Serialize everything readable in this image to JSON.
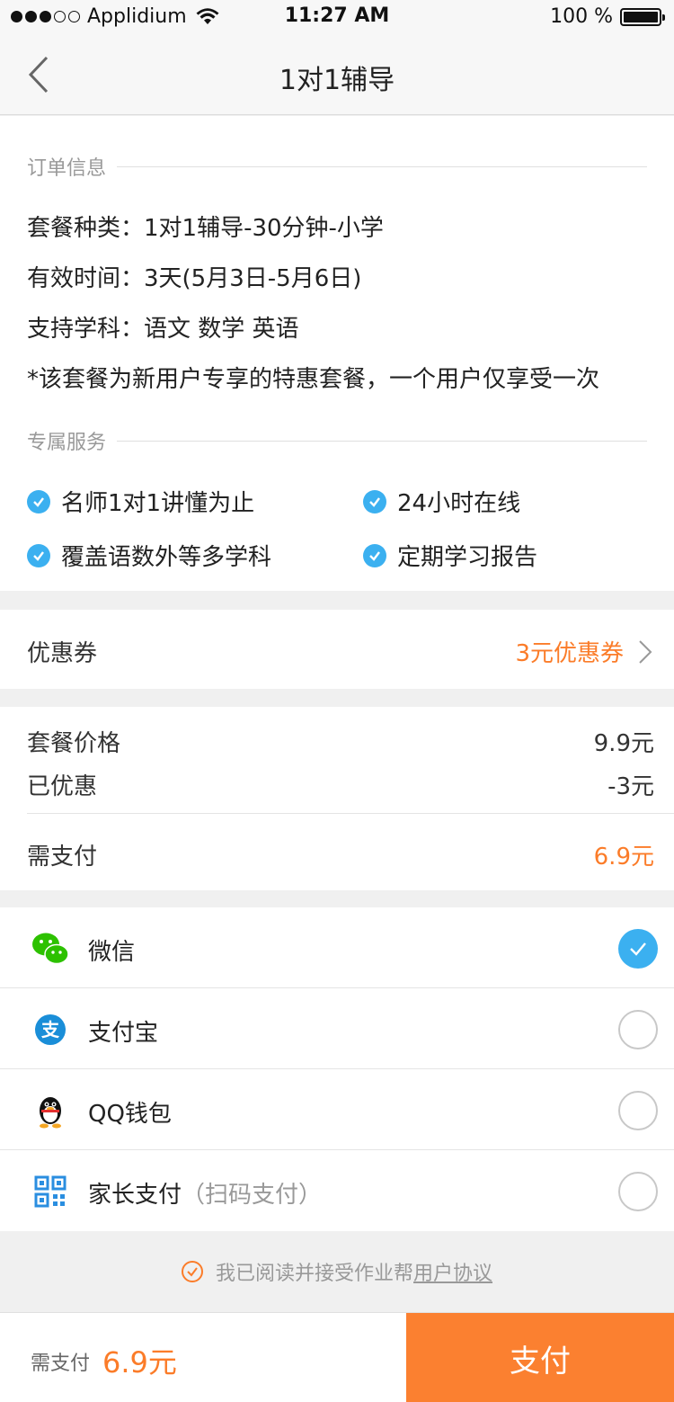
{
  "status_bar": {
    "carrier": "Applidium",
    "time": "11:27 AM",
    "battery": "100 %"
  },
  "nav": {
    "title": "1对1辅导"
  },
  "order": {
    "section_title": "订单信息",
    "package_type": "套餐种类：1对1辅导-30分钟-小学",
    "valid_time": "有效时间：3天(5月3日-5月6日)",
    "subjects": "支持学科：语文 数学 英语",
    "note": "*该套餐为新用户专享的特惠套餐，一个用户仅享受一次"
  },
  "services": {
    "section_title": "专属服务",
    "items": [
      "名师1对1讲懂为止",
      "24小时在线",
      "覆盖语数外等多学科",
      "定期学习报告"
    ]
  },
  "coupon": {
    "label": "优惠券",
    "value": "3元优惠券"
  },
  "price": {
    "package_label": "套餐价格",
    "package_value": "9.9元",
    "discount_label": "已优惠",
    "discount_value": "-3元",
    "due_label": "需支付",
    "due_value": "6.9元"
  },
  "payment": {
    "methods": [
      {
        "label": "微信",
        "sub": "",
        "icon": "wechat-icon",
        "selected": true
      },
      {
        "label": "支付宝",
        "sub": "",
        "icon": "alipay-icon",
        "selected": false
      },
      {
        "label": "QQ钱包",
        "sub": "",
        "icon": "qq-penguin-icon",
        "selected": false
      },
      {
        "label": "家长支付",
        "sub": "（扫码支付）",
        "icon": "qr-code-icon",
        "selected": false
      }
    ]
  },
  "agreement": {
    "text": "我已阅读并接受作业帮",
    "link": "用户协议"
  },
  "footer": {
    "due_label": "需支付",
    "due_value": "6.9元",
    "pay_button": "支付"
  },
  "colors": {
    "accent": "#fb7c29",
    "check_blue": "#3bb0f0"
  }
}
